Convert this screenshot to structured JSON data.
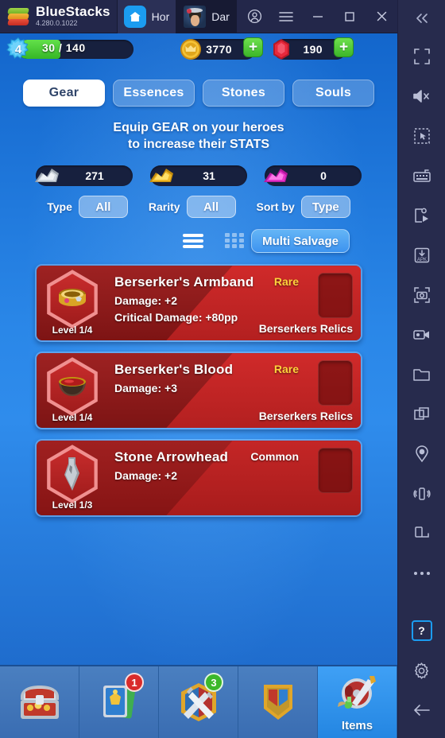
{
  "window": {
    "app_name": "BlueStacks",
    "version": "4.280.0.1022",
    "tabs": [
      {
        "label": "Hor",
        "icon": "home-icon",
        "active": false
      },
      {
        "label": "Dar",
        "icon": "game-avatar-icon",
        "active": true
      }
    ],
    "controls": [
      {
        "name": "account-icon"
      },
      {
        "name": "menu-icon"
      },
      {
        "name": "minimize-icon"
      },
      {
        "name": "maximize-icon"
      },
      {
        "name": "close-icon"
      }
    ]
  },
  "sidebar": {
    "collapse_icon": "chevron-double-left-icon",
    "items": [
      {
        "icon": "fullscreen-icon"
      },
      {
        "icon": "mute-icon"
      },
      {
        "icon": "select-region-icon"
      },
      {
        "icon": "keyboard-icon"
      },
      {
        "icon": "macro-play-icon"
      },
      {
        "icon": "install-apk-icon"
      },
      {
        "icon": "screenshot-icon"
      },
      {
        "icon": "record-video-icon"
      },
      {
        "icon": "folder-icon"
      },
      {
        "icon": "multi-instance-icon"
      },
      {
        "icon": "location-icon"
      },
      {
        "icon": "shake-icon"
      },
      {
        "icon": "rotate-icon"
      },
      {
        "icon": "more-icon"
      }
    ],
    "bottom_items": [
      {
        "icon": "help-icon",
        "label": "?",
        "highlight_color": "#1b9cf0"
      },
      {
        "icon": "settings-gear-icon"
      },
      {
        "icon": "back-arrow-icon"
      }
    ]
  },
  "game": {
    "topbar": {
      "level": "4",
      "xp": "30 / 140",
      "xp_percent": 37,
      "gold": {
        "icon": "gold-coin-icon",
        "value": "3770",
        "add_label": "+"
      },
      "gems": {
        "icon": "red-gem-icon",
        "value": "190",
        "add_label": "+"
      }
    },
    "category_tabs": [
      {
        "label": "Gear",
        "active": true
      },
      {
        "label": "Essences",
        "active": false
      },
      {
        "label": "Stones",
        "active": false
      },
      {
        "label": "Souls",
        "active": false
      }
    ],
    "subtitle_line1": "Equip GEAR on your heroes",
    "subtitle_line2": "to increase their STATS",
    "materials": [
      {
        "icon": "silver-scrap-icon",
        "value": "271"
      },
      {
        "icon": "gold-scrap-icon",
        "value": "31"
      },
      {
        "icon": "pink-crystal-icon",
        "value": "0"
      }
    ],
    "filters": [
      {
        "label": "Type",
        "value": "All"
      },
      {
        "label": "Rarity",
        "value": "All"
      },
      {
        "label": "Sort by",
        "value": "Type"
      }
    ],
    "view_toggles": [
      {
        "icon": "list-view-icon",
        "active": true
      },
      {
        "icon": "grid-view-icon",
        "active": false
      }
    ],
    "multi_salvage_label": "Multi Salvage",
    "items": [
      {
        "name": "Berserker's Armband",
        "rarity": "Rare",
        "rarity_class": "rare",
        "stats": [
          "Damage: +2",
          "Critical Damage: +80pp"
        ],
        "level": "Level 1/4",
        "set": "Berserkers Relics",
        "icon": "golden-armband-icon"
      },
      {
        "name": "Berserker's Blood",
        "rarity": "Rare",
        "rarity_class": "rare",
        "stats": [
          "Damage: +3"
        ],
        "level": "Level 1/4",
        "set": "Berserkers Relics",
        "icon": "blood-bowl-icon"
      },
      {
        "name": "Stone Arrowhead",
        "rarity": "Common",
        "rarity_class": "common",
        "stats": [
          "Damage: +2"
        ],
        "level": "Level 1/3",
        "set": "",
        "icon": "stone-arrowhead-icon"
      }
    ],
    "bottom_nav": [
      {
        "icon": "treasure-chest-icon",
        "label": "",
        "badge": "",
        "badge_color": "",
        "active": false
      },
      {
        "icon": "cards-icon",
        "label": "",
        "badge": "1",
        "badge_color": "#d92b2b",
        "active": false
      },
      {
        "icon": "weapons-icon",
        "label": "",
        "badge": "3",
        "badge_color": "#3cb82b",
        "active": false
      },
      {
        "icon": "banner-icon",
        "label": "",
        "badge": "",
        "badge_color": "",
        "active": false
      },
      {
        "icon": "items-icon",
        "label": "Items",
        "badge": "",
        "badge_color": "",
        "active": true
      }
    ]
  },
  "colors": {
    "accent_blue": "#1b9cf0",
    "rare_gold": "#ffd23b",
    "badge_red": "#d92b2b",
    "badge_green": "#3cb82b"
  }
}
